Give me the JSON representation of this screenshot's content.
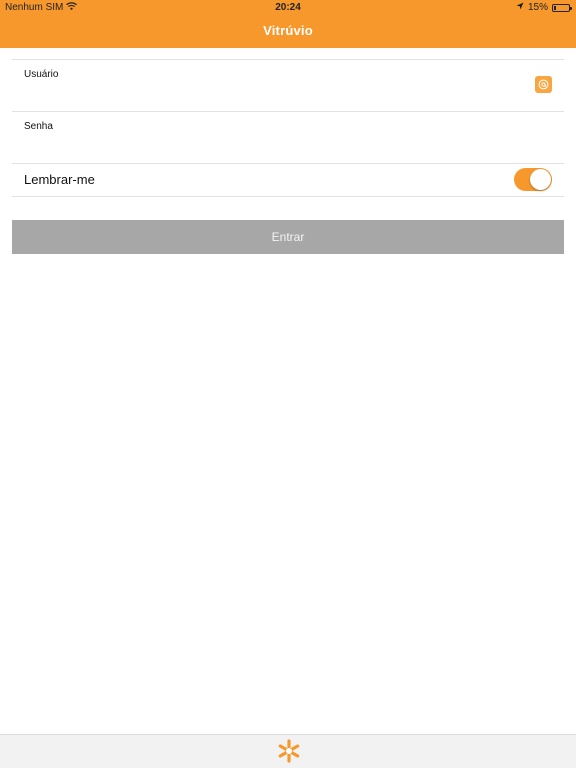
{
  "status_bar": {
    "carrier": "Nenhum SIM",
    "time": "20:24",
    "battery_text": "15%",
    "battery_level": 0.15,
    "icons": [
      "wifi-icon",
      "location-arrow-icon",
      "battery-icon"
    ]
  },
  "nav": {
    "title": "Vitrúvio"
  },
  "form": {
    "username_label": "Usuário",
    "username_value": "",
    "password_label": "Senha",
    "password_value": "",
    "remember_label": "Lembrar-me",
    "remember_on": true
  },
  "login_button": {
    "label": "Entrar"
  },
  "bottom_bar": {
    "logo_icon": "asterisk-logo-icon"
  },
  "colors": {
    "accent": "#f7982c",
    "button_disabled": "#a7a7a7",
    "bottom_bar": "#f2f2f2"
  }
}
